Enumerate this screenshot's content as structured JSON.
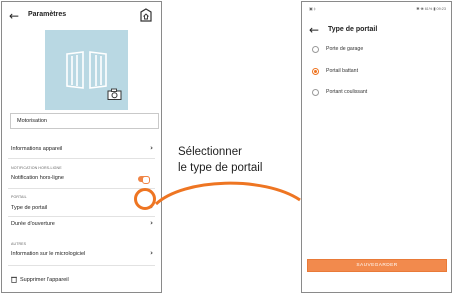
{
  "left_screen": {
    "header": {
      "back_glyph": "←",
      "title": "Paramètres",
      "home_icon": "home-shield-icon"
    },
    "camera_icon": "camera-icon",
    "name_field": {
      "value": "Motorisation"
    },
    "rows": {
      "device_info": "Informations appareil",
      "offline_section": "NOTIFICATION HORS-LIGNE",
      "offline_notif": "Notification hors-ligne",
      "portal_section": "PORTAIL",
      "portal_type": "Type de portail",
      "opening_duration": "Durée d'ouverture",
      "other_section": "AUTRES",
      "firmware_info": "Information sur le micrologiciel",
      "delete_device": "Supprimer l'appareil"
    },
    "chevron_glyph": "›",
    "toggle_on": true
  },
  "annotation": {
    "line1": "Sélectionner",
    "line2": "le type de portail",
    "color": "#ee7522"
  },
  "right_screen": {
    "status": {
      "left": "▣ ‡",
      "right": "✱ ❀ 61% ▮ 09:23"
    },
    "header": {
      "back_glyph": "←",
      "title": "Type de portail"
    },
    "options": [
      {
        "label": "Porte de garage",
        "selected": false
      },
      {
        "label": "Portail battant",
        "selected": true
      },
      {
        "label": "Portant coulissant",
        "selected": false
      }
    ],
    "save_label": "SAUVEGARDER"
  },
  "colors": {
    "accent": "#ee7522",
    "photo_bg": "#b9d8e3",
    "save_bg": "#f28a4d"
  }
}
